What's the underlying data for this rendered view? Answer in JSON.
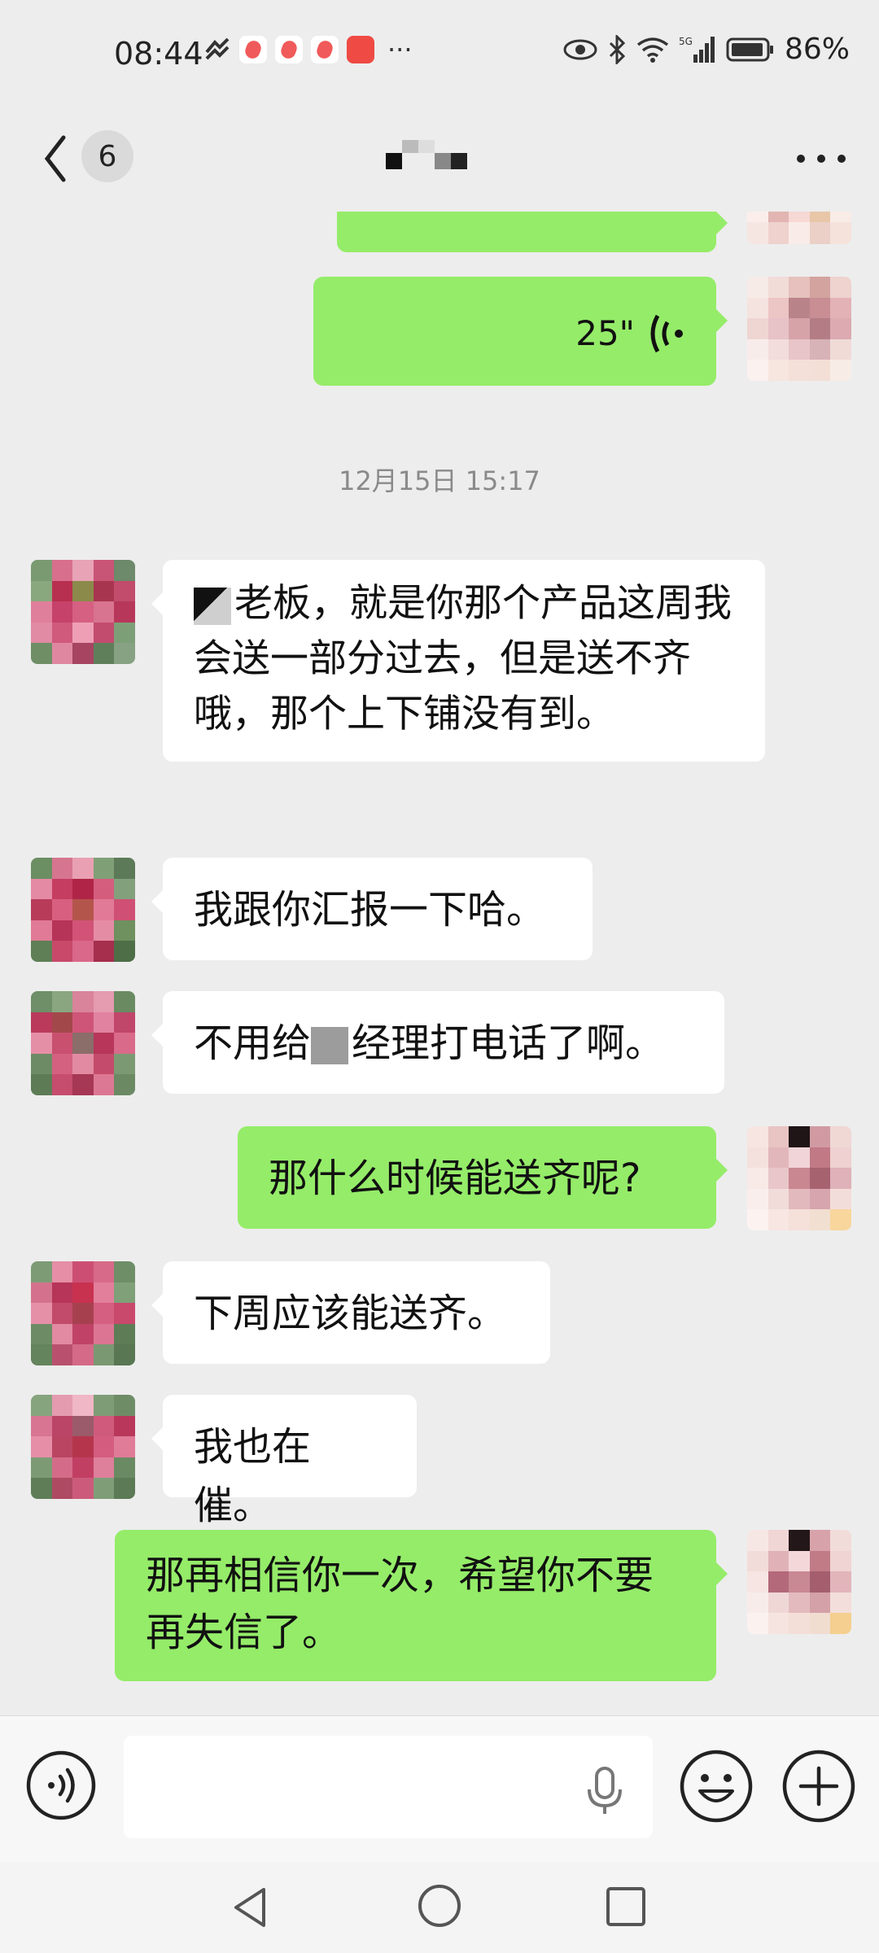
{
  "status_bar": {
    "time": "08:44",
    "battery_percent": "86%",
    "network_label": "5G"
  },
  "nav": {
    "unread_count": "6"
  },
  "timestamp": "12月15日 15:17",
  "messages": [
    {
      "side": "out",
      "type": "voice",
      "duration": ""
    },
    {
      "side": "out",
      "type": "voice",
      "duration": "25\""
    },
    {
      "side": "in",
      "type": "text",
      "text": "老板，就是你那个产品这周我会送一部分过去，但是送不齐哦，那个上下铺没有到。"
    },
    {
      "side": "in",
      "type": "text",
      "text": "我跟你汇报一下哈。"
    },
    {
      "side": "in",
      "type": "text",
      "text_before": "不用给",
      "text_after": "经理打电话了啊。"
    },
    {
      "side": "out",
      "type": "text",
      "text": "那什么时候能送齐呢?"
    },
    {
      "side": "in",
      "type": "text",
      "text": "下周应该能送齐。"
    },
    {
      "side": "in",
      "type": "text",
      "text": "我也在催。"
    },
    {
      "side": "out",
      "type": "text",
      "text": "那再相信你一次，希望你不要再失信了。"
    }
  ],
  "input": {
    "placeholder": ""
  },
  "icons": {
    "back": "chevron-left-icon",
    "more": "more-dots-icon",
    "voice_toggle": "voice-mode-icon",
    "mic": "microphone-icon",
    "emoji": "emoji-icon",
    "plus": "plus-icon"
  },
  "colors": {
    "outgoing_bubble": "#95EC69",
    "incoming_bubble": "#FFFFFF",
    "background": "#EDEDED"
  }
}
